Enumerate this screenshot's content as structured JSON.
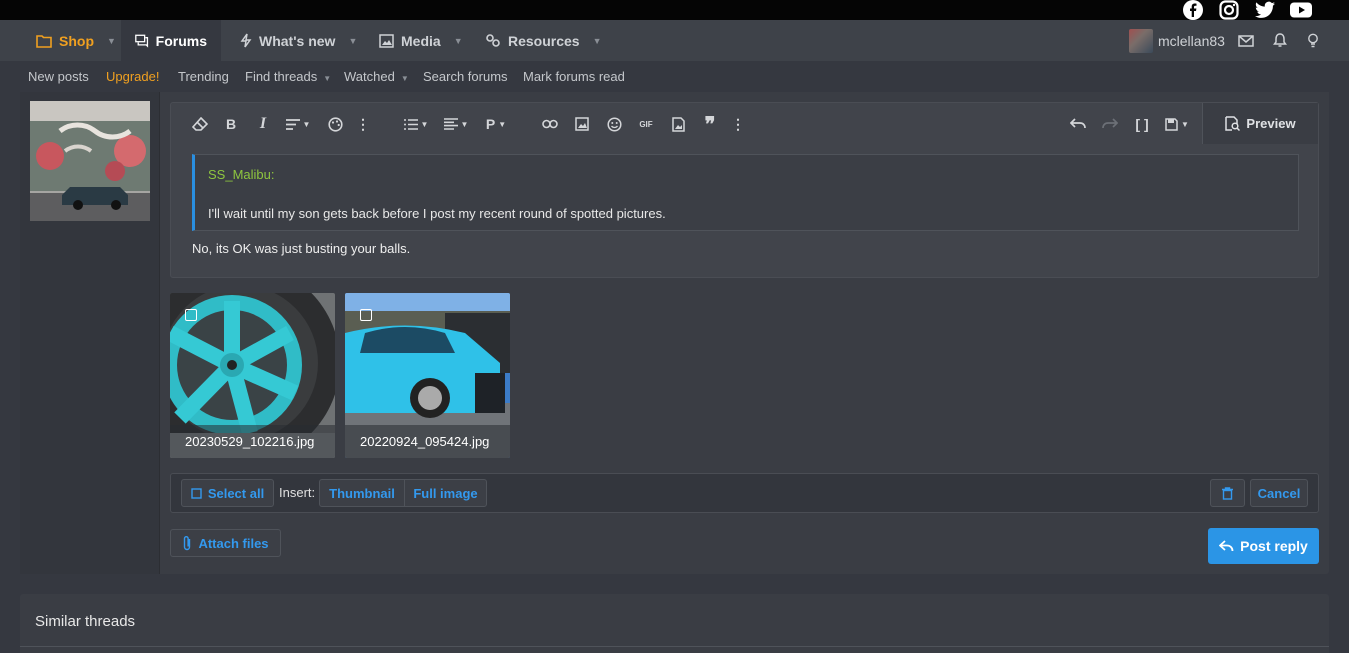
{
  "nav": {
    "tabs": [
      {
        "label": "Shop",
        "icon": "folder-icon"
      },
      {
        "label": "Forums",
        "icon": "forum-icon"
      },
      {
        "label": "What's new",
        "icon": "bolt-icon"
      },
      {
        "label": "Media",
        "icon": "image-icon"
      },
      {
        "label": "Resources",
        "icon": "cogs-icon"
      }
    ],
    "username": "mclellan83"
  },
  "subnav": {
    "items": [
      "New posts",
      "Upgrade!",
      "Trending",
      "Find threads",
      "Watched",
      "Search forums",
      "Mark forums read"
    ]
  },
  "editor": {
    "preview_label": "Preview",
    "quote_author": "SS_Malibu:",
    "quote_text": "I'll wait until my son gets back before I post my recent round of spotted pictures.",
    "reply_text": "No, its OK was just busting your balls."
  },
  "attachments": [
    {
      "filename": "20230529_102216.jpg"
    },
    {
      "filename": "20220924_095424.jpg"
    }
  ],
  "attach_bar": {
    "select_all": "Select all",
    "insert_label": "Insert:",
    "thumbnail": "Thumbnail",
    "full_image": "Full image",
    "cancel": "Cancel"
  },
  "attach_files": "Attach files",
  "post_reply": "Post reply",
  "similar_threads": "Similar threads",
  "colors": {
    "accent": "#2b95e6",
    "shop": "#f0a020",
    "quote_author": "#8ec63f"
  }
}
